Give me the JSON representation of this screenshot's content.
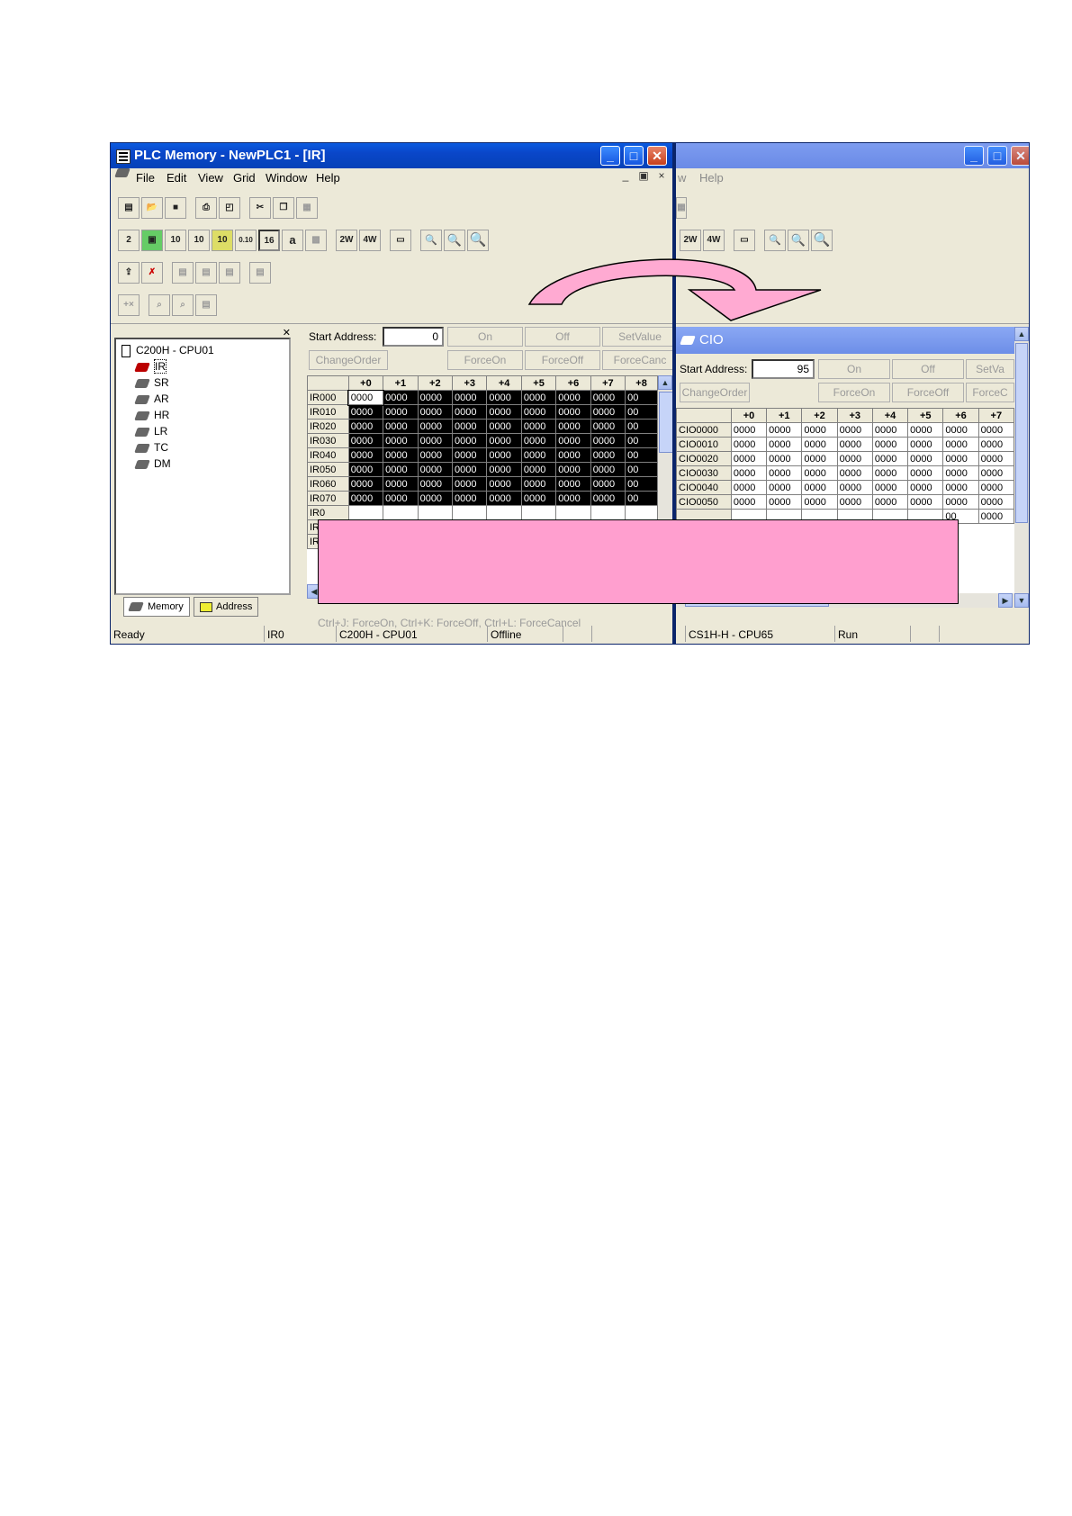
{
  "left_window": {
    "title": "PLC Memory - NewPLC1 - [IR]",
    "menu": [
      "File",
      "Edit",
      "View",
      "Grid",
      "Window",
      "Help"
    ],
    "mdi": [
      "_",
      "▣",
      "×"
    ],
    "caption": [
      "_",
      "□",
      "✕"
    ],
    "toolbar_row2": [
      "2",
      "10",
      "10",
      "10",
      "0.10",
      "16",
      "a",
      "",
      "2W",
      "4W",
      "",
      "",
      "",
      ""
    ],
    "tree_root": "C200H - CPU01",
    "tree_items": [
      "IR",
      "SR",
      "AR",
      "HR",
      "LR",
      "TC",
      "DM"
    ],
    "tabs": [
      "Memory",
      "Address"
    ],
    "start_address_label": "Start Address:",
    "start_address_value": "0",
    "buttons_row1": [
      "On",
      "Off",
      "SetValue"
    ],
    "buttons_row2": [
      "ChangeOrder",
      "ForceOn",
      "ForceOff",
      "ForceCanc"
    ],
    "grid_headers": [
      "+0",
      "+1",
      "+2",
      "+3",
      "+4",
      "+5",
      "+6",
      "+7",
      "+8"
    ],
    "grid_rows": [
      {
        "label": "IR000",
        "cells": [
          "0000",
          "0000",
          "0000",
          "0000",
          "0000",
          "0000",
          "0000",
          "0000",
          "00"
        ]
      },
      {
        "label": "IR010",
        "cells": [
          "0000",
          "0000",
          "0000",
          "0000",
          "0000",
          "0000",
          "0000",
          "0000",
          "00"
        ]
      },
      {
        "label": "IR020",
        "cells": [
          "0000",
          "0000",
          "0000",
          "0000",
          "0000",
          "0000",
          "0000",
          "0000",
          "00"
        ]
      },
      {
        "label": "IR030",
        "cells": [
          "0000",
          "0000",
          "0000",
          "0000",
          "0000",
          "0000",
          "0000",
          "0000",
          "00"
        ]
      },
      {
        "label": "IR040",
        "cells": [
          "0000",
          "0000",
          "0000",
          "0000",
          "0000",
          "0000",
          "0000",
          "0000",
          "00"
        ]
      },
      {
        "label": "IR050",
        "cells": [
          "0000",
          "0000",
          "0000",
          "0000",
          "0000",
          "0000",
          "0000",
          "0000",
          "00"
        ]
      },
      {
        "label": "IR060",
        "cells": [
          "0000",
          "0000",
          "0000",
          "0000",
          "0000",
          "0000",
          "0000",
          "0000",
          "00"
        ]
      },
      {
        "label": "IR070",
        "cells": [
          "0000",
          "0000",
          "0000",
          "0000",
          "0000",
          "0000",
          "0000",
          "0000",
          "00"
        ]
      },
      {
        "label": "IR0",
        "cells": [
          "",
          "",
          "",
          "",
          "",
          "",
          "",
          "",
          ""
        ]
      },
      {
        "label": "IR0",
        "cells": [
          "",
          "",
          "",
          "",
          "",
          "",
          "",
          "",
          ""
        ]
      },
      {
        "label": "IR",
        "cells": [
          "",
          "",
          "",
          "",
          "",
          "",
          "",
          "",
          ""
        ]
      }
    ],
    "hint": "Ctrl+J: ForceOn,    Ctrl+K: ForceOff,    Ctrl+L: ForceCancel",
    "status": [
      "Ready",
      "IR0",
      "C200H - CPU01",
      "Offline"
    ]
  },
  "right_window": {
    "menu_partial": [
      "w",
      "Help"
    ],
    "child_title": "CIO",
    "start_address_label": "Start Address:",
    "start_address_value": "95",
    "buttons_row1": [
      "On",
      "Off",
      "SetVa"
    ],
    "buttons_row2": [
      "ChangeOrder",
      "ForceOn",
      "ForceOff",
      "ForceC"
    ],
    "grid_headers": [
      "+0",
      "+1",
      "+2",
      "+3",
      "+4",
      "+5",
      "+6",
      "+7"
    ],
    "grid_rows": [
      {
        "label": "CIO0000",
        "cells": [
          "0000",
          "0000",
          "0000",
          "0000",
          "0000",
          "0000",
          "0000",
          "0000"
        ]
      },
      {
        "label": "CIO0010",
        "cells": [
          "0000",
          "0000",
          "0000",
          "0000",
          "0000",
          "0000",
          "0000",
          "0000"
        ]
      },
      {
        "label": "CIO0020",
        "cells": [
          "0000",
          "0000",
          "0000",
          "0000",
          "0000",
          "0000",
          "0000",
          "0000"
        ]
      },
      {
        "label": "CIO0030",
        "cells": [
          "0000",
          "0000",
          "0000",
          "0000",
          "0000",
          "0000",
          "0000",
          "0000"
        ]
      },
      {
        "label": "CIO0040",
        "cells": [
          "0000",
          "0000",
          "0000",
          "0000",
          "0000",
          "0000",
          "0000",
          "0000"
        ]
      },
      {
        "label": "CIO0050",
        "cells": [
          "0000",
          "0000",
          "0000",
          "0000",
          "0000",
          "0000",
          "0000",
          "0000"
        ]
      },
      {
        "label": "",
        "cells": [
          "",
          "",
          "",
          "",
          "",
          "",
          "00",
          "0000"
        ]
      }
    ],
    "status": [
      "CS1H-H - CPU65",
      "Run"
    ]
  },
  "colors": {
    "overlay": "#ff9fcf",
    "arrow": "#ffaad2"
  }
}
